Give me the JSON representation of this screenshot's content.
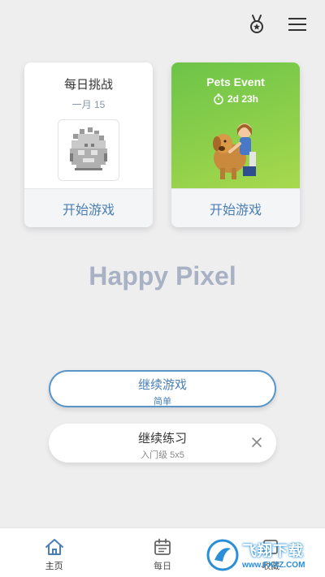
{
  "header": {
    "medal_icon": "medal-icon",
    "menu_icon": "hamburger-menu-icon"
  },
  "daily_card": {
    "title": "每日挑战",
    "date": "一月 15",
    "button_label": "开始游戏"
  },
  "event_card": {
    "title": "Pets Event",
    "timer": "2d 23h",
    "button_label": "开始游戏"
  },
  "app_title": "Happy Pixel",
  "continue_game": {
    "label": "继续游戏",
    "sub": "简单"
  },
  "continue_practice": {
    "label": "继续练习",
    "sub": "入门级 5x5"
  },
  "tabbar": {
    "tabs": [
      {
        "label": "主页",
        "icon": "home-icon",
        "active": true
      },
      {
        "label": "每日",
        "icon": "calendar-icon",
        "active": false
      },
      {
        "label": "收藏",
        "icon": "collection-icon",
        "active": false
      }
    ]
  },
  "watermark": {
    "text": "飞翔下载",
    "url": "www.FXXZ.COM"
  },
  "colors": {
    "accent": "#4a7fb5",
    "event_green": "#7ccb49",
    "title_gray": "#a9b2c4",
    "background": "#eeeeef"
  }
}
